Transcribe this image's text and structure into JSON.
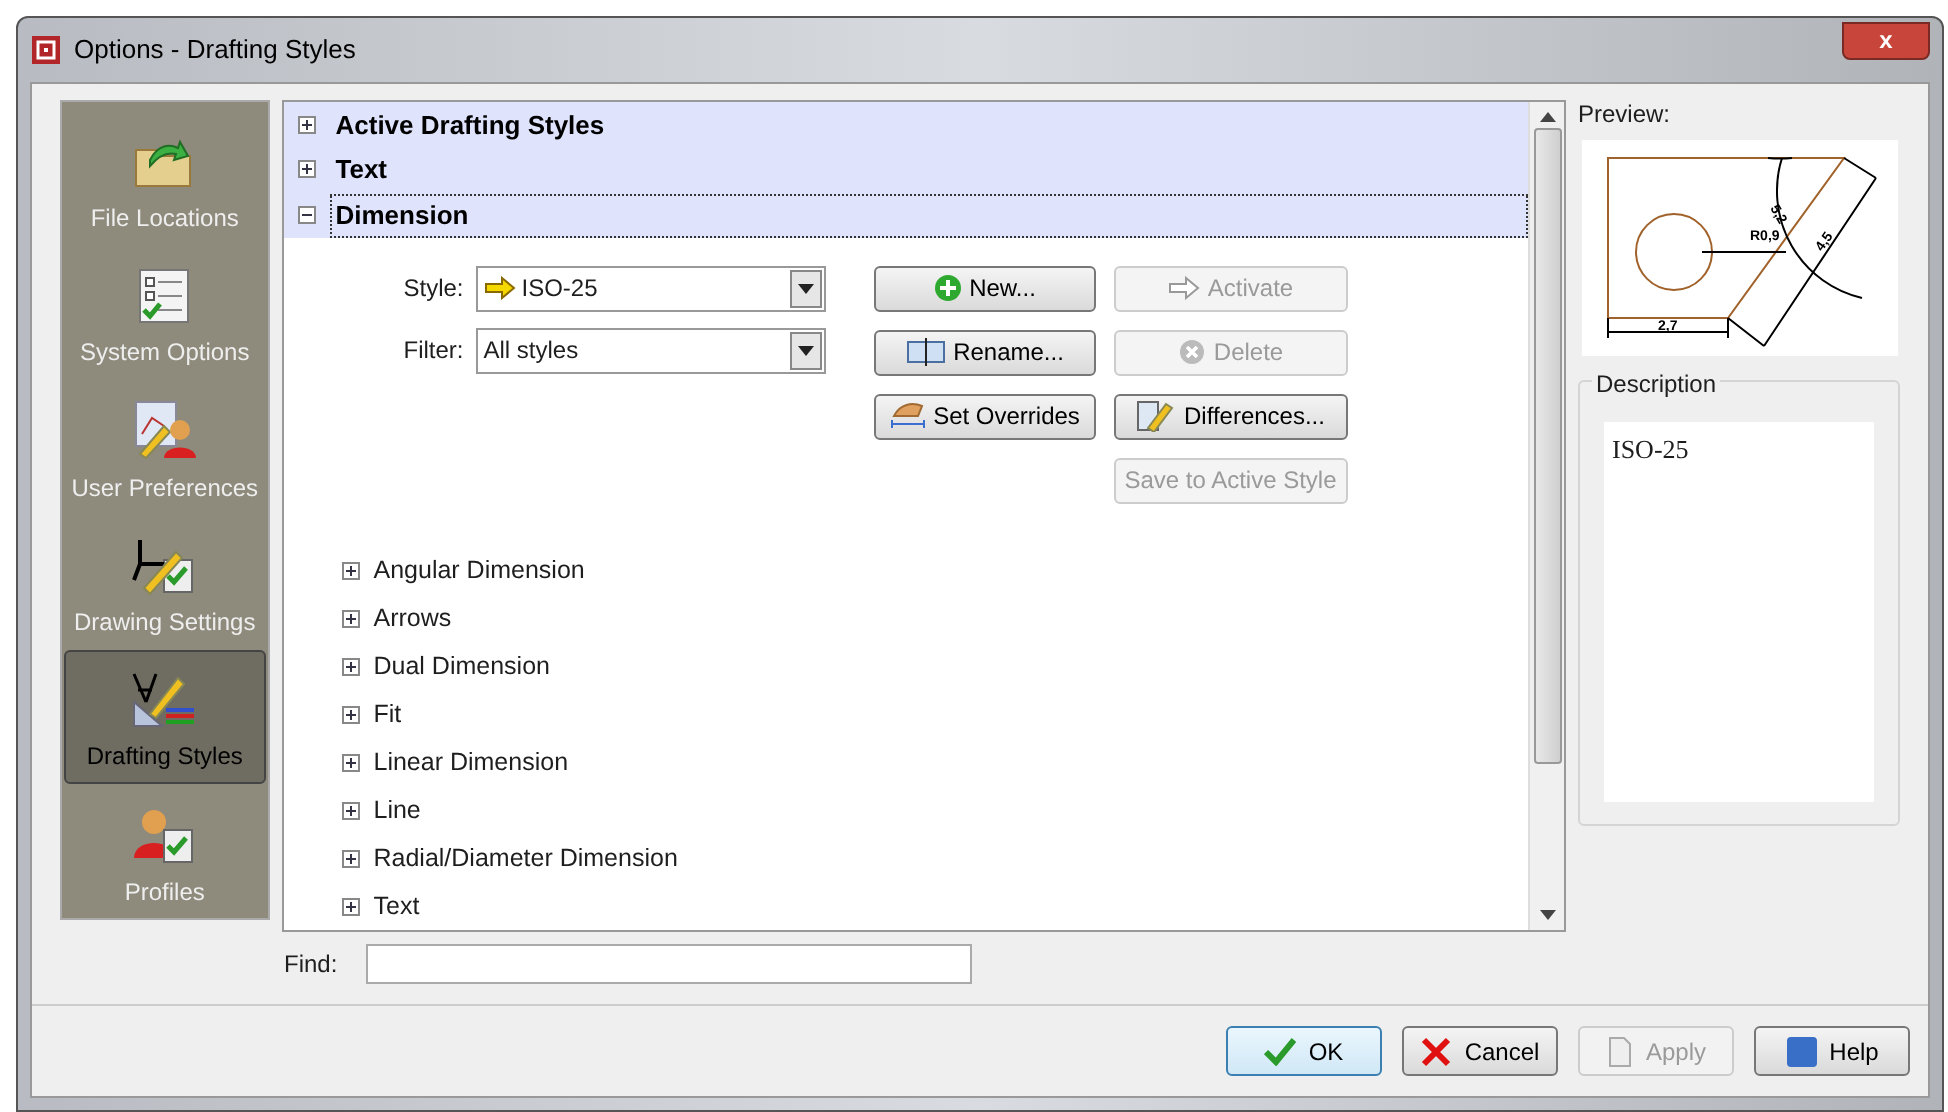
{
  "window": {
    "title": "Options - Drafting Styles",
    "close": "x"
  },
  "sidebar": {
    "items": [
      {
        "label": "File Locations",
        "kind": "folder",
        "selected": false
      },
      {
        "label": "System Options",
        "kind": "checklist",
        "selected": false
      },
      {
        "label": "User Preferences",
        "kind": "preferences",
        "selected": false
      },
      {
        "label": "Drawing Settings",
        "kind": "drawing",
        "selected": false
      },
      {
        "label": "Drafting Styles",
        "kind": "drafting",
        "selected": true
      },
      {
        "label": "Profiles",
        "kind": "profiles",
        "selected": false
      }
    ]
  },
  "tree": {
    "items": [
      {
        "label": "Active Drafting Styles",
        "expanded": false,
        "selected": false
      },
      {
        "label": "Text",
        "expanded": false,
        "selected": false
      },
      {
        "label": "Dimension",
        "expanded": true,
        "selected": true,
        "style": {
          "label": "Style:",
          "value": "ISO-25"
        },
        "filter": {
          "label": "Filter:",
          "value": "All styles"
        },
        "buttons": [
          {
            "label": "New...",
            "kind": "new",
            "disabled": false
          },
          {
            "label": "Activate",
            "kind": "activate",
            "disabled": true
          },
          {
            "label": "Rename...",
            "kind": "rename",
            "disabled": false
          },
          {
            "label": "Delete",
            "kind": "delete",
            "disabled": true
          },
          {
            "label": "Set Overrides",
            "kind": "overrides",
            "disabled": false
          },
          {
            "label": "Differences...",
            "kind": "differences",
            "disabled": false
          },
          {
            "label": "Save to Active Style",
            "kind": "save",
            "disabled": true
          }
        ],
        "children": [
          {
            "label": "Angular Dimension",
            "expanded": false
          },
          {
            "label": "Arrows",
            "expanded": false
          },
          {
            "label": "Dual Dimension",
            "expanded": false
          },
          {
            "label": "Fit",
            "expanded": false
          },
          {
            "label": "Linear Dimension",
            "expanded": false
          },
          {
            "label": "Line",
            "expanded": false
          },
          {
            "label": "Radial/Diameter Dimension",
            "expanded": false
          },
          {
            "label": "Text",
            "expanded": false
          }
        ]
      }
    ]
  },
  "preview": {
    "label": "Preview:",
    "dims": [
      "2,7",
      "R0,9",
      "4,5",
      "5,2"
    ]
  },
  "description": {
    "label": "Description",
    "text": "ISO-25"
  },
  "find": {
    "label": "Find:"
  },
  "buttons": [
    {
      "label": "OK",
      "kind": "ok",
      "disabled": false,
      "default": true
    },
    {
      "label": "Cancel",
      "kind": "cancel",
      "disabled": false,
      "default": false
    },
    {
      "label": "Apply",
      "kind": "apply",
      "disabled": true,
      "default": false
    },
    {
      "label": "Help",
      "kind": "help",
      "disabled": false,
      "default": false
    }
  ]
}
